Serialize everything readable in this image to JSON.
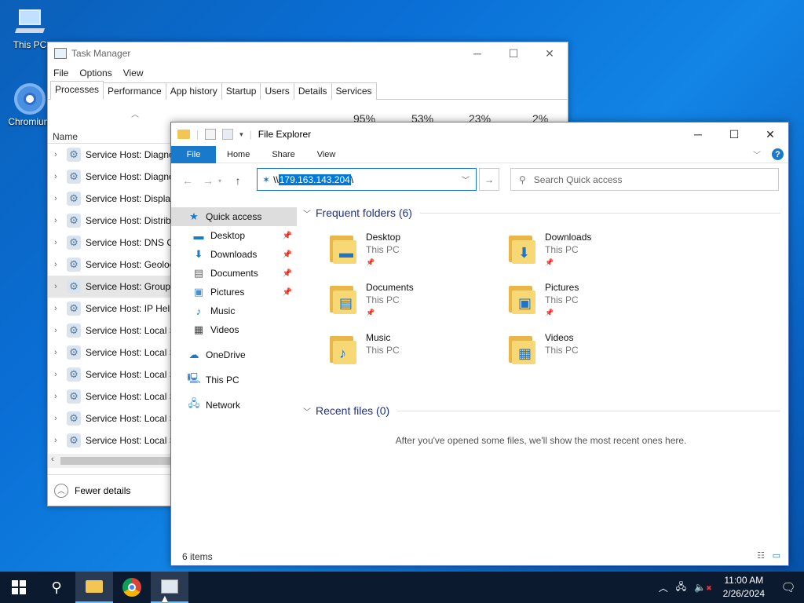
{
  "desktop": {
    "icons": [
      {
        "label": "This PC",
        "icon": "this-pc-icon"
      },
      {
        "label": "Chromium",
        "icon": "chromium-icon"
      }
    ]
  },
  "task_manager": {
    "title": "Task Manager",
    "menu": [
      "File",
      "Options",
      "View"
    ],
    "tabs": [
      "Processes",
      "Performance",
      "App history",
      "Startup",
      "Users",
      "Details",
      "Services"
    ],
    "active_tab": "Processes",
    "percentages": [
      "95%",
      "53%",
      "23%",
      "2%"
    ],
    "column_name": "Name",
    "rows": [
      "Service Host: Diagno",
      "Service Host: Diagno",
      "Service Host: Display",
      "Service Host: Distribu",
      "Service Host: DNS Cl",
      "Service Host: Geoloc",
      "Service Host: Group",
      "Service Host: IP Help",
      "Service Host: Local S",
      "Service Host: Local S",
      "Service Host: Local S",
      "Service Host: Local S",
      "Service Host: Local S",
      "Service Host: Local S"
    ],
    "selected_row": 6,
    "fewer_details": "Fewer details"
  },
  "file_explorer": {
    "title": "File Explorer",
    "ribbon_tabs": [
      "File",
      "Home",
      "Share",
      "View"
    ],
    "address_prefix": "\\\\",
    "address_selected": "179.163.143.204",
    "address_suffix": "\\",
    "search_placeholder": "Search Quick access",
    "nav": {
      "quick_access": "Quick access",
      "items": [
        "Desktop",
        "Downloads",
        "Documents",
        "Pictures",
        "Music",
        "Videos"
      ],
      "onedrive": "OneDrive",
      "this_pc": "This PC",
      "network": "Network"
    },
    "frequent_header": "Frequent folders (6)",
    "folders": [
      {
        "name": "Desktop",
        "location": "This PC",
        "pinned": true
      },
      {
        "name": "Downloads",
        "location": "This PC",
        "pinned": true
      },
      {
        "name": "Documents",
        "location": "This PC",
        "pinned": true
      },
      {
        "name": "Pictures",
        "location": "This PC",
        "pinned": true
      },
      {
        "name": "Music",
        "location": "This PC",
        "pinned": false
      },
      {
        "name": "Videos",
        "location": "This PC",
        "pinned": false
      }
    ],
    "recent_header": "Recent files (0)",
    "recent_empty": "After you've opened some files, we'll show the most recent ones here.",
    "status": "6 items"
  },
  "taskbar": {
    "time": "11:00 AM",
    "date": "2/26/2024"
  },
  "colors": {
    "accent": "#1979ca",
    "desktop": "#0a6fd6"
  }
}
